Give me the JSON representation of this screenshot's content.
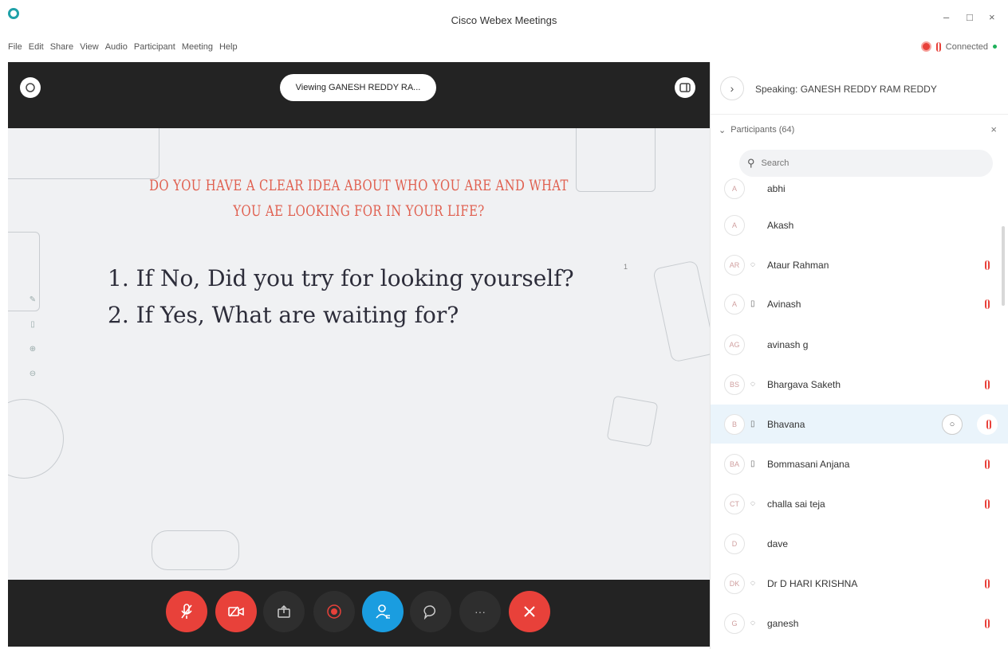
{
  "window": {
    "title": "Cisco Webex Meetings",
    "minimize": "–",
    "maximize": "□",
    "close": "×"
  },
  "menu": [
    "File",
    "Edit",
    "Share",
    "View",
    "Audio",
    "Participant",
    "Meeting",
    "Help"
  ],
  "status": {
    "connection": "Connected"
  },
  "stage": {
    "viewing_label": "Viewing GANESH REDDY RA..."
  },
  "slide": {
    "title": "Do you have a clear idea about who you are and what you ae looking for in your life?",
    "items": [
      "1. If No, Did you try for looking yourself?",
      "2. If Yes, What are waiting for?"
    ],
    "page_indicator": "1"
  },
  "speaking": {
    "text": "Speaking: GANESH REDDY RAM REDDY"
  },
  "participants": {
    "header": "Participants (64)",
    "search_placeholder": "Search",
    "list": [
      {
        "initials": "A",
        "device": "",
        "name": "abhi",
        "muted": false
      },
      {
        "initials": "A",
        "device": "",
        "name": "Akash",
        "muted": false
      },
      {
        "initials": "AR",
        "device": "headset",
        "name": "Ataur Rahman",
        "muted": true
      },
      {
        "initials": "A",
        "device": "phone",
        "name": "Avinash",
        "muted": true
      },
      {
        "initials": "AG",
        "device": "",
        "name": "avinash g",
        "muted": false
      },
      {
        "initials": "BS",
        "device": "headset",
        "name": "Bhargava Saketh",
        "muted": true
      },
      {
        "initials": "B",
        "device": "phone",
        "name": "Bhavana",
        "muted": true,
        "selected": true
      },
      {
        "initials": "BA",
        "device": "phone",
        "name": "Bommasani Anjana",
        "muted": true
      },
      {
        "initials": "CT",
        "device": "headset",
        "name": "challa sai teja",
        "muted": true
      },
      {
        "initials": "D",
        "device": "",
        "name": "dave",
        "muted": false
      },
      {
        "initials": "DK",
        "device": "headset",
        "name": "Dr D HARI KRISHNA",
        "muted": true
      },
      {
        "initials": "G",
        "device": "headset",
        "name": "ganesh",
        "muted": true
      }
    ]
  },
  "colors": {
    "red": "#e8413a",
    "blue": "#1a9de0",
    "dark": "#232323",
    "accent_title": "#e06050"
  }
}
